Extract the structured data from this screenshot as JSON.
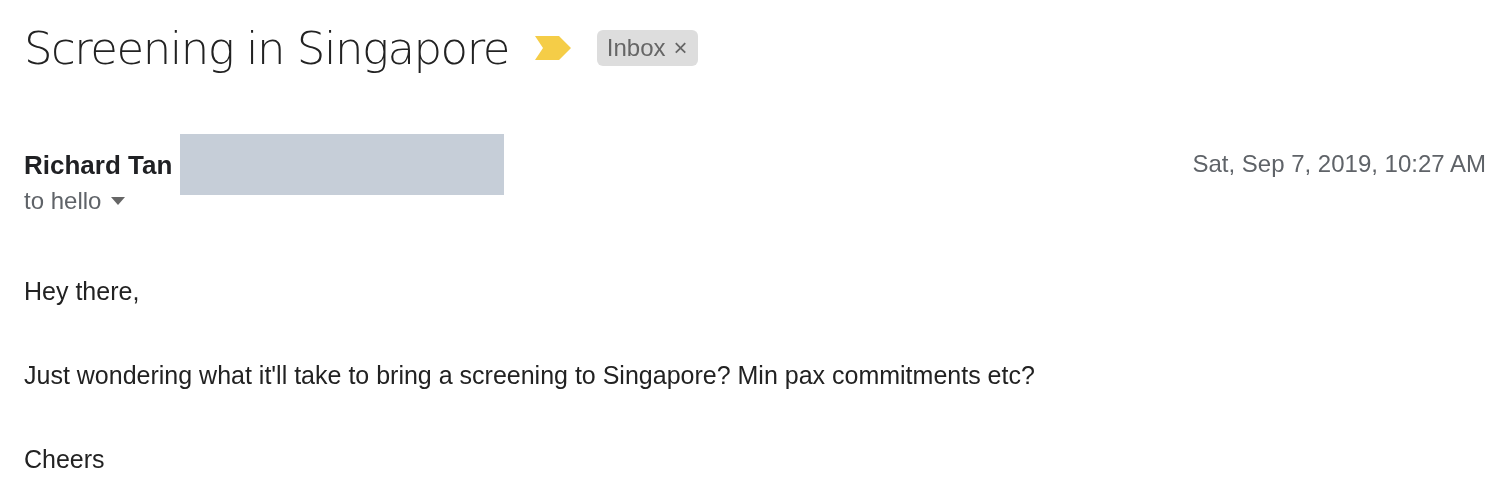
{
  "subject": {
    "title": "Screening in Singapore",
    "important": true,
    "labels": [
      {
        "text": "Inbox",
        "remove": "×"
      }
    ]
  },
  "message": {
    "sender": "Richard Tan",
    "recipient": "to hello",
    "date": "Sat, Sep 7, 2019, 10:27 AM",
    "body": [
      "Hey there,",
      "Just wondering what it'll take to bring a screening to Singapore? Min pax commitments etc?",
      "Cheers"
    ]
  }
}
